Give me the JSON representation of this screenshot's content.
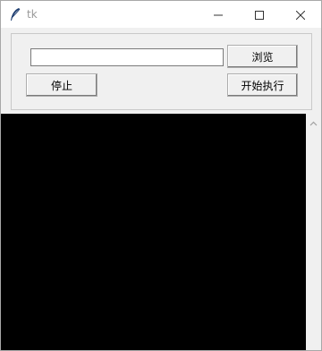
{
  "window": {
    "title": "tk",
    "icons": {
      "app": "feather-icon",
      "minimize": "minimize-icon",
      "maximize": "maximize-icon",
      "close": "close-icon"
    }
  },
  "controls": {
    "path_value": "",
    "browse_label": "浏览",
    "stop_label": "停止",
    "start_label": "开始执行"
  },
  "output": {
    "background": "#000000",
    "text": ""
  },
  "scrollbar": {
    "up_icon": "chevron-up-icon"
  }
}
